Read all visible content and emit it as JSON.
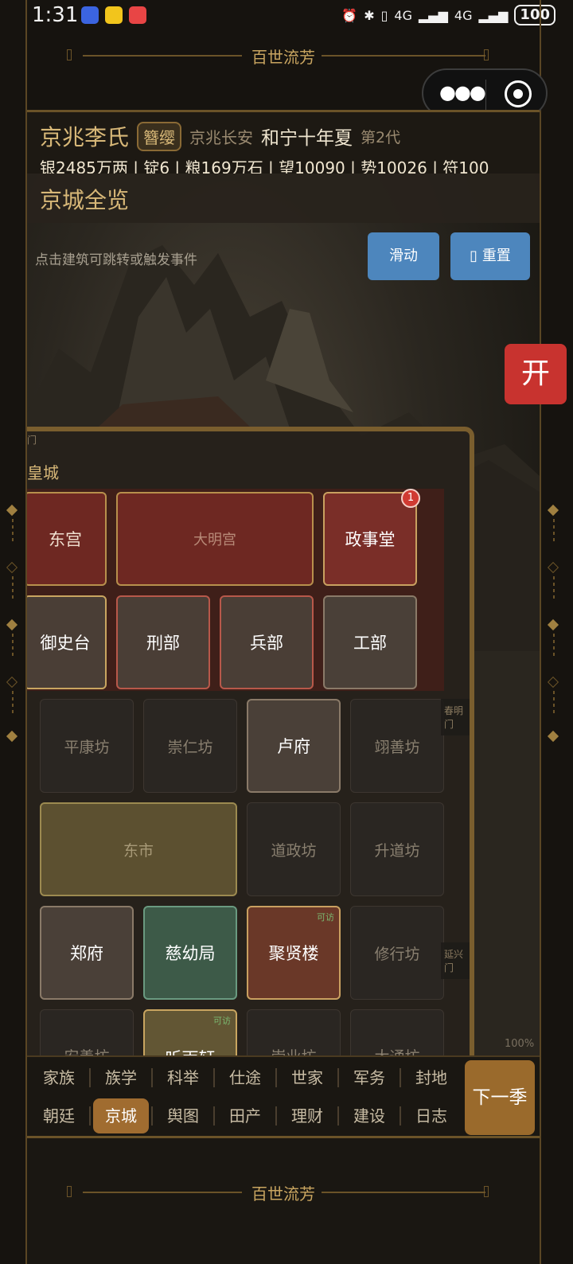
{
  "status_bar": {
    "time": "1:31",
    "network_1": "4G",
    "network_2": "4G",
    "battery": "100"
  },
  "app_title": "百世流芳",
  "header": {
    "clan": "京兆李氏",
    "badge": "簪缨",
    "location": "京兆长安",
    "era": "和宁十年夏",
    "generation": "第2代",
    "resources": "银2485万两 | 锭6 | 粮169万石 | 望10090 | 势10026 | 符100"
  },
  "section": {
    "title": "京城全览",
    "hint": "点击建筑可跳转或触发事件",
    "slide_button": "滑动",
    "reset_button": "重置"
  },
  "open_button": "开",
  "map": {
    "gate_top": "门",
    "city_label": "皇城",
    "palace_row1": {
      "east_palace": "东宫",
      "daming": "大明宫",
      "zhengshitang": "政事堂",
      "notif_count": "1"
    },
    "palace_row2": {
      "yushitai": "御史台",
      "xingbu": "刑部",
      "bingbu": "兵部",
      "gongbu": "工部"
    },
    "gate_chunming": "春明门",
    "gate_yanxing": "延兴门",
    "ward_row1": {
      "c1": "平康坊",
      "c2": "崇仁坊",
      "c3": "卢府",
      "c4": "翊善坊"
    },
    "ward_row2": {
      "market": "东市",
      "c3": "道政坊",
      "c4": "升道坊"
    },
    "ward_row3": {
      "c1": "郑府",
      "c2": "慈幼局",
      "c3": "聚贤楼",
      "c3_tag": "可访",
      "c4": "修行坊"
    },
    "ward_row4": {
      "c1": "安善坊",
      "c2": "听雨轩",
      "c2_tag": "可访",
      "c3": "崇业坊",
      "c4": "大通坊"
    },
    "zoom": "100%"
  },
  "nav": {
    "row1": [
      "家族",
      "族学",
      "科举",
      "仕途",
      "世家",
      "军务",
      "封地"
    ],
    "row2": [
      "朝廷",
      "京城",
      "舆图",
      "田产",
      "理财",
      "建设",
      "日志"
    ],
    "active": "京城",
    "next_button": "下一季"
  },
  "footer_title": "百世流芳"
}
